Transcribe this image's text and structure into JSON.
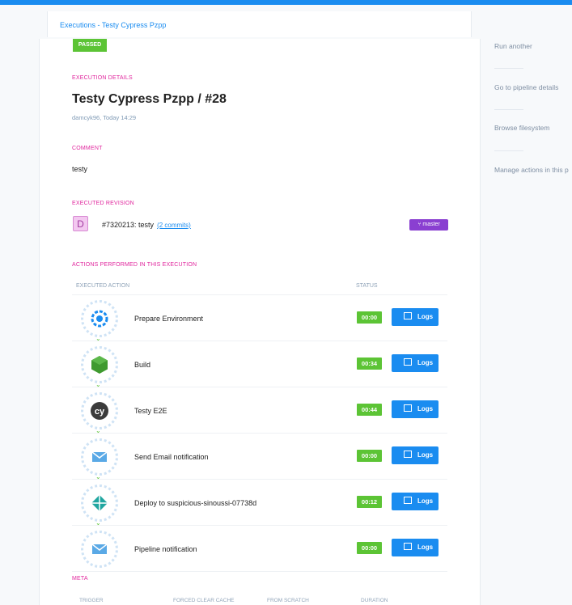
{
  "breadcrumb": {
    "link": "Executions - Testy Cypress Pzpp"
  },
  "status_badge": "PASSED",
  "execution_details": {
    "section_label": "EXECUTION DETAILS",
    "title": "Testy Cypress Pzpp / #28",
    "subtitle": "damcyk96, Today 14:29"
  },
  "comment": {
    "section_label": "COMMENT",
    "text": "testy"
  },
  "revision": {
    "section_label": "EXECUTED REVISION",
    "avatar_letter": "D",
    "text": "#7320213: testy",
    "commits_link": "(2 commits)",
    "branch": "master"
  },
  "actions": {
    "section_label": "ACTIONS PERFORMED IN THIS EXECUTION",
    "col_action": "EXECUTED ACTION",
    "col_status": "STATUS",
    "logs_label": "Logs",
    "rows": [
      {
        "name": "Prepare Environment",
        "duration": "00:00",
        "icon": "gear-icon"
      },
      {
        "name": "Build",
        "duration": "00:34",
        "icon": "nodejs-icon"
      },
      {
        "name": "Testy E2E",
        "duration": "00:44",
        "icon": "cypress-icon"
      },
      {
        "name": "Send Email notification",
        "duration": "00:00",
        "icon": "email-icon"
      },
      {
        "name": "Deploy to suspicious-sinoussi-07738d",
        "duration": "00:12",
        "icon": "netlify-icon"
      },
      {
        "name": "Pipeline notification",
        "duration": "00:00",
        "icon": "email-icon"
      }
    ]
  },
  "meta": {
    "section_label": "META",
    "columns": [
      "TRIGGER",
      "FORCED CLEAR CACHE",
      "FROM SCRATCH",
      "DURATION"
    ]
  },
  "sidebar": {
    "items": [
      "Run another",
      "Go to pipeline details",
      "Browse filesystem",
      "Manage actions in this p"
    ]
  },
  "colors": {
    "accent": "#1a8cf0",
    "success": "#5cc435",
    "section": "#e0269d",
    "branch": "#8a3fd1"
  }
}
